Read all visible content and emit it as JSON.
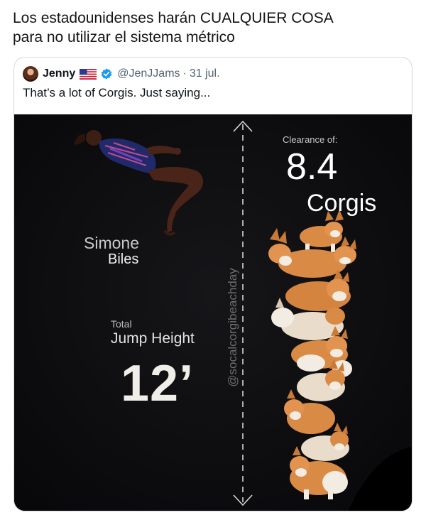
{
  "caption": {
    "line1": "Los estadounidenses harán CUALQUIER COSA",
    "line2": "para no utilizar el sistema métrico"
  },
  "tweet": {
    "author_name": "Jenny",
    "handle": "@JenJJams",
    "date": "31 jul.",
    "separator": "·",
    "text": "That’s a lot of Corgis. Just saying..."
  },
  "infographic": {
    "athlete_first_name": "Simone",
    "athlete_last_name": "Biles",
    "total_label": "Total",
    "jump_height_label": "Jump Height",
    "jump_height_value": "12’",
    "clearance_label": "Clearance of:",
    "clearance_value": "8.4",
    "clearance_unit": "Corgis",
    "watermark": "@socalcorgibeachday"
  },
  "colors": {
    "media_background": "#0d0d0f",
    "verified_badge": "#1d9bf0",
    "corgi_orange": "#d98a45",
    "corgi_white": "#f3ece3"
  },
  "icons": {
    "verified": "verified-badge-icon",
    "flag": "us-flag-icon"
  }
}
